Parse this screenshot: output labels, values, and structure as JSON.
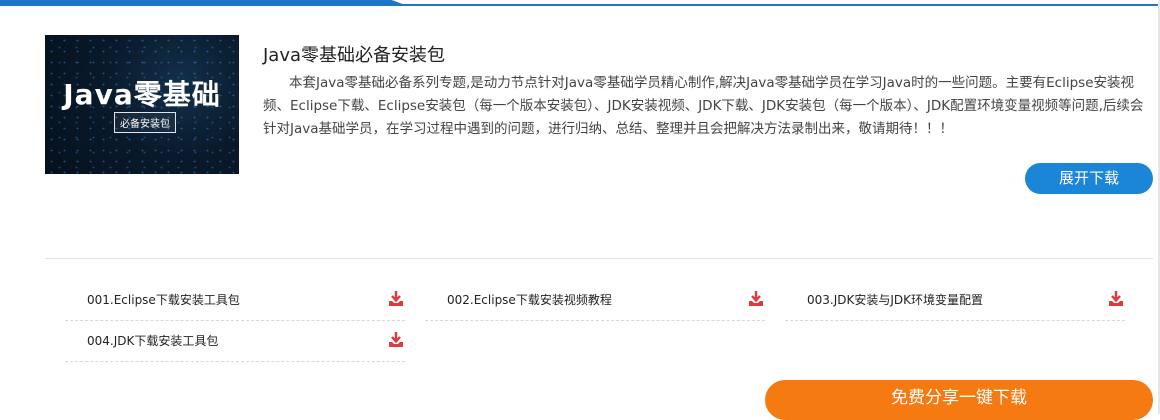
{
  "course": {
    "thumb_title": "Java零基础",
    "thumb_badge": "必备安装包",
    "title": "Java零基础必备安装包",
    "description": "本套Java零基础必备系列专题,是动力节点针对Java零基础学员精心制作,解决Java零基础学员在学习Java时的一些问题。主要有Eclipse安装视频、Eclipse下载、Eclipse安装包（每一个版本安装包）、JDK安装视频、JDK下载、JDK安装包（每一个版本）、JDK配置环境变量视频等问题,后续会针对Java基础学员，在学习过程中遇到的问题，进行归纳、总结、整理并且会把解决方法录制出来，敬请期待！！！",
    "expand_label": "展开下载"
  },
  "resources": [
    {
      "label": "001.Eclipse下载安装工具包",
      "icon": "download-icon"
    },
    {
      "label": "002.Eclipse下载安装视频教程",
      "icon": "download-icon"
    },
    {
      "label": "003.JDK安装与JDK环境变量配置",
      "icon": "download-icon"
    },
    {
      "label": "004.JDK下载安装工具包",
      "icon": "download-icon"
    }
  ],
  "share_label": "免费分享一键下载",
  "colors": {
    "accent_blue": "#1b86d7",
    "download_red": "#e0393e",
    "share_orange": "#f57a12"
  }
}
